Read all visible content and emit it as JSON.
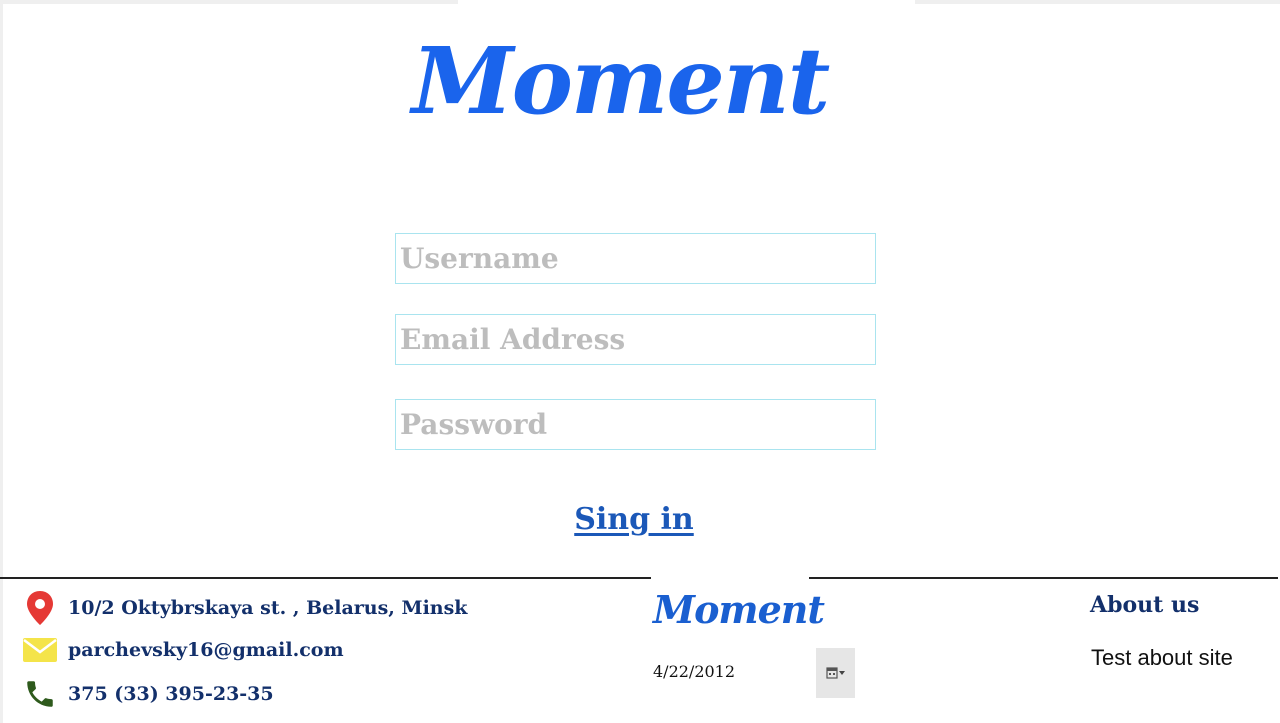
{
  "header": {
    "brand": "Moment"
  },
  "form": {
    "username_placeholder": "Username",
    "email_placeholder": "Email Address",
    "password_placeholder": "Password",
    "submit_label": "Sing in"
  },
  "footer": {
    "address": "10/2 Oktybrskaya st. , Belarus, Minsk",
    "email": "parchevsky16@gmail.com",
    "phone": "375 (33) 395-23-35",
    "brand": "Moment",
    "date_value": "4/22/2012",
    "about_title": "About us",
    "about_text": "Test about site"
  },
  "colors": {
    "brand_blue": "#1a64ec",
    "footer_navy": "#13306b",
    "field_border": "#a9e4ef",
    "pin_red": "#e53935",
    "mail_yellow": "#f4e44a",
    "phone_green": "#2e5a1c"
  },
  "icons": {
    "address": "map-pin-icon",
    "email": "envelope-icon",
    "phone": "phone-icon",
    "date": "calendar-icon"
  }
}
